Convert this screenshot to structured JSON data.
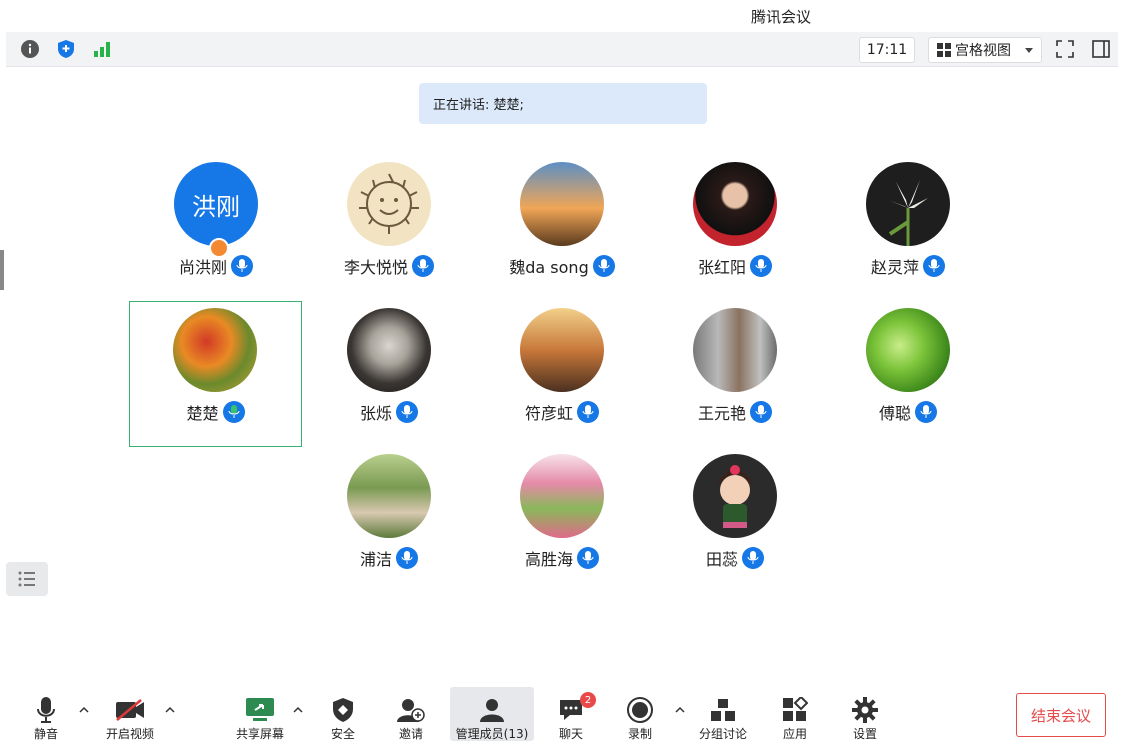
{
  "window": {
    "title": "腾讯会议"
  },
  "topbar": {
    "info_icon": "info-icon",
    "security_icon": "shield-icon",
    "signal_icon": "signal-icon",
    "clock": "17:11",
    "view_label": "宫格视图"
  },
  "speaking": {
    "text": "正在讲话: 楚楚;"
  },
  "participants": [
    {
      "name": "尚洪刚",
      "avatar_text": "洪刚",
      "avatar_type": "text",
      "host": true
    },
    {
      "name": "李大悦悦",
      "avatar_type": "sun-drawing"
    },
    {
      "name": "魏da song",
      "avatar_type": "sunset-photo"
    },
    {
      "name": "张红阳",
      "avatar_type": "woman-portrait"
    },
    {
      "name": "赵灵萍",
      "avatar_type": "lily-flower"
    },
    {
      "name": "楚楚",
      "avatar_type": "flower-painting",
      "active": true
    },
    {
      "name": "张烁",
      "avatar_type": "bearded-man"
    },
    {
      "name": "符彦虹",
      "avatar_type": "reading-person"
    },
    {
      "name": "王元艳",
      "avatar_type": "street-photo"
    },
    {
      "name": "傅聪",
      "avatar_type": "green-leaf"
    },
    {
      "name": "浦洁",
      "avatar_type": "tai-chi-woman"
    },
    {
      "name": "高胜海",
      "avatar_type": "flower-field"
    },
    {
      "name": "田蕊",
      "avatar_type": "cartoon-girl"
    }
  ],
  "bottombar": {
    "mute": "静音",
    "video": "开启视频",
    "share": "共享屏幕",
    "security": "安全",
    "invite": "邀请",
    "members": "管理成员(13)",
    "chat": "聊天",
    "chat_badge": "2",
    "record": "录制",
    "breakout": "分组讨论",
    "apps": "应用",
    "settings": "设置",
    "end": "结束会议"
  },
  "colors": {
    "accent": "#1677e6",
    "active_border": "#39b070",
    "danger": "#e44b4b"
  }
}
